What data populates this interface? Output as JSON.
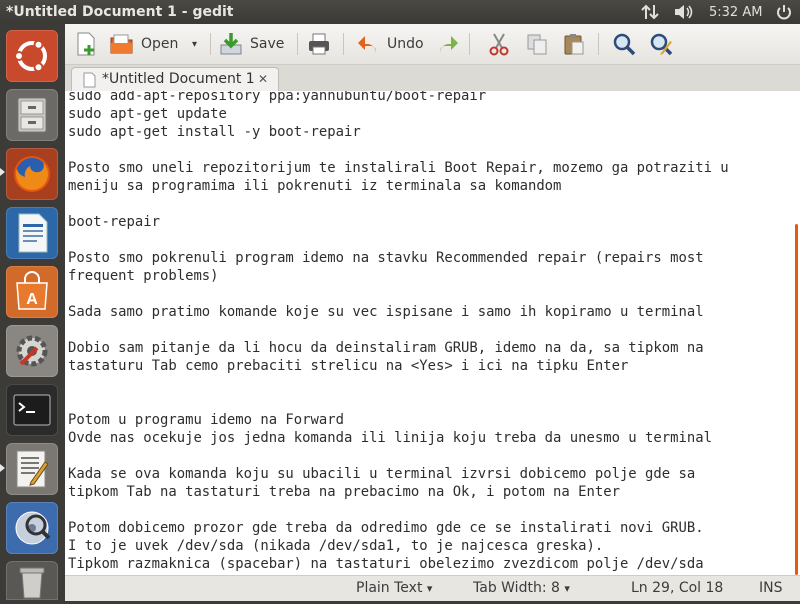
{
  "window": {
    "title": "*Untitled Document 1 - gedit"
  },
  "indicators": {
    "clock": "5:32 AM",
    "network_icon": "network-arrows-icon",
    "volume_icon": "speaker-icon",
    "power_icon": "power-icon"
  },
  "launcher": {
    "items": [
      {
        "name": "ubuntu-dash",
        "icon": "ubuntu-logo-icon"
      },
      {
        "name": "files",
        "icon": "file-cabinet-icon"
      },
      {
        "name": "firefox",
        "icon": "firefox-icon"
      },
      {
        "name": "libreoffice-writer",
        "icon": "writer-document-icon"
      },
      {
        "name": "software-center",
        "icon": "shopping-bag-icon"
      },
      {
        "name": "system-settings",
        "icon": "gear-wrench-icon"
      },
      {
        "name": "terminal",
        "icon": "terminal-icon"
      },
      {
        "name": "gedit",
        "icon": "text-editor-icon"
      },
      {
        "name": "disk-utility",
        "icon": "disk-magnifier-icon"
      },
      {
        "name": "trash",
        "icon": "trash-icon"
      }
    ]
  },
  "toolbar": {
    "open_label": "Open",
    "save_label": "Save",
    "undo_label": "Undo"
  },
  "tab": {
    "label": "*Untitled Document 1",
    "close": "✕"
  },
  "editor": {
    "lines": [
      "sudo add-apt-repository ppa:yannubuntu/boot-repair",
      "sudo apt-get update",
      "sudo apt-get install -y boot-repair",
      "",
      "Posto smo uneli repozitorijum te instalirali Boot Repair, mozemo ga potraziti u",
      "meniju sa programima ili pokrenuti iz terminala sa komandom",
      "",
      "boot-repair",
      "",
      "Posto smo pokrenuli program idemo na stavku Recommended repair (repairs most",
      "frequent problems)",
      "",
      "Sada samo pratimo komande koje su vec ispisane i samo ih kopiramo u terminal",
      "",
      "Dobio sam pitanje da li hocu da deinstaliram GRUB, idemo na da, sa tipkom na",
      "tastaturu Tab cemo prebaciti strelicu na <Yes> i ici na tipku Enter",
      "",
      "",
      "Potom u programu idemo na Forward",
      "Ovde nas ocekuje jos jedna komanda ili linija koju treba da unesmo u terminal",
      "",
      "Kada se ova komanda koju su ubacili u terminal izvrsi dobicemo polje gde sa",
      "tipkom Tab na tastaturi treba na prebacimo na Ok, i potom na Enter",
      "",
      "Potom dobicemo prozor gde treba da odredimo gde ce se instalirati novi GRUB.",
      "I to je uvek /dev/sda (nikada /dev/sda1, to je najcesca greska).",
      "Tipkom razmaknica (spacebar) na tastaturi obelezimo zvezdicom polje /dev/sda"
    ]
  },
  "statusbar": {
    "language": "Plain Text",
    "tab_width": "Tab Width:  8",
    "position": "Ln 29, Col 18",
    "mode": "INS",
    "dropdown_arrow": "▾"
  },
  "colors": {
    "accent": "#e05a1c",
    "launcher_bg": "#3d3b38",
    "panel_bg": "#3c3b37"
  }
}
